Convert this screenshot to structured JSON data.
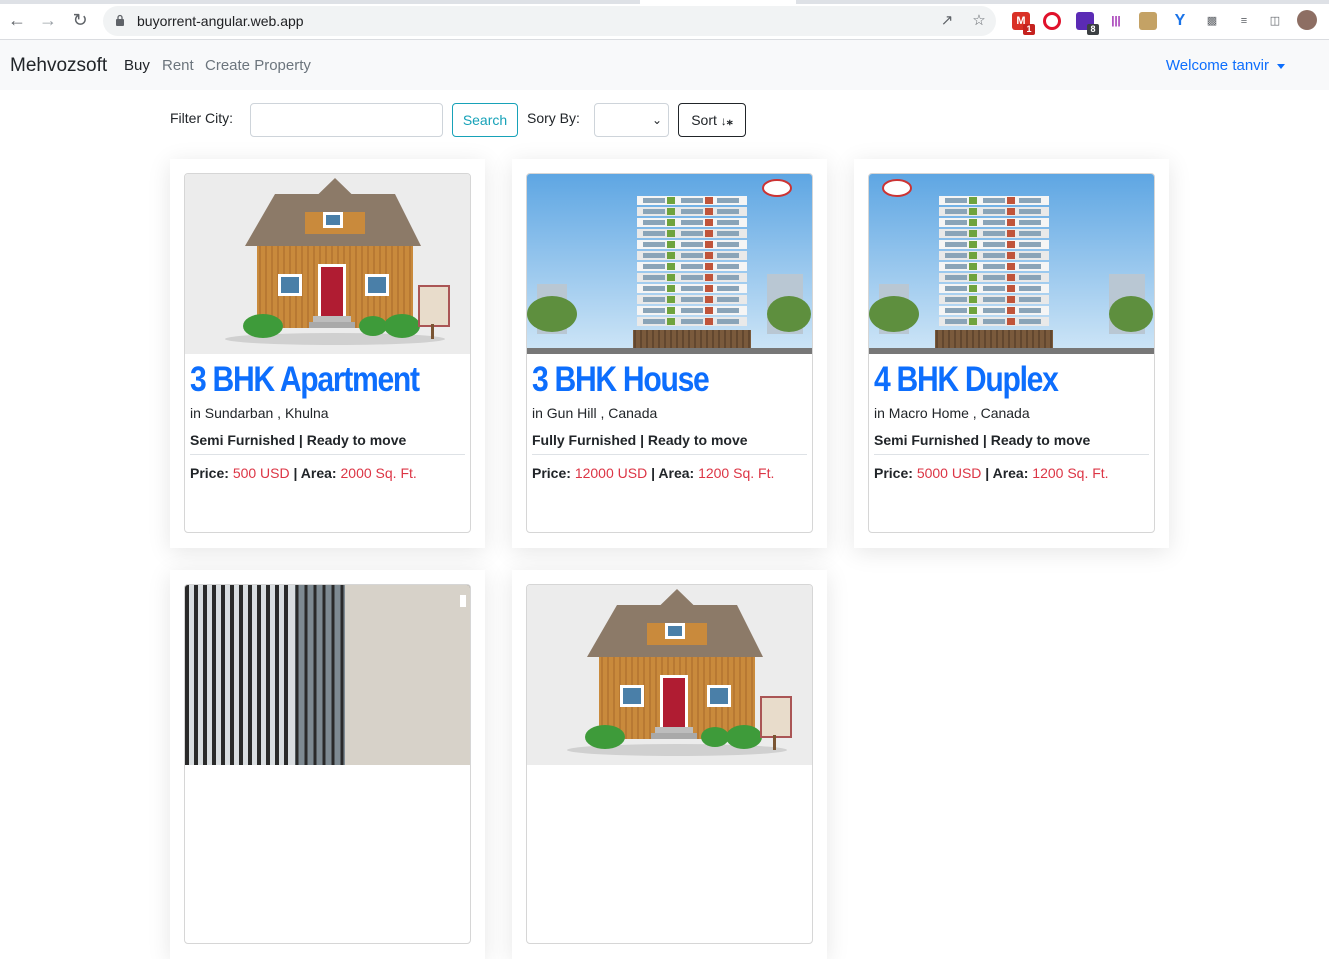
{
  "browser": {
    "url": "buyorrent-angular.web.app",
    "extensions": [
      {
        "name": "gmail-icon",
        "badge": "1",
        "color": "#d93025"
      },
      {
        "name": "opera-icon",
        "badge": "",
        "color": "#e0112b"
      },
      {
        "name": "extension-purple-icon",
        "badge": "8",
        "color": "#5b2bb5"
      },
      {
        "name": "library-icon",
        "badge": "",
        "color": "#9c27b0"
      },
      {
        "name": "folder-face-icon",
        "badge": "",
        "color": "#c4a265"
      },
      {
        "name": "y-extension-icon",
        "badge": "",
        "color": "#1a73e8"
      },
      {
        "name": "puzzle-icon",
        "badge": "",
        "color": "#5f6368"
      },
      {
        "name": "media-list-icon",
        "badge": "",
        "color": "#5f6368"
      },
      {
        "name": "side-panel-icon",
        "badge": "",
        "color": "#5f6368"
      }
    ]
  },
  "navbar": {
    "brand": "Mehvozsoft",
    "links": [
      {
        "label": "Buy",
        "active": true
      },
      {
        "label": "Rent",
        "active": false
      },
      {
        "label": "Create Property",
        "active": false
      }
    ],
    "welcome": "Welcome tanvir"
  },
  "filters": {
    "city_label": "Filter City:",
    "city_value": "",
    "search_label": "Search",
    "sort_label": "Sory By:",
    "sort_value": "",
    "sort_button": "Sort"
  },
  "properties": [
    {
      "title": "3 BHK Apartment",
      "location": "in Sundarban , Khulna",
      "furnishing": "Semi Furnished | Ready to move",
      "price_label": "Price:",
      "price": "500 USD",
      "area_label": "| Area:",
      "area": "2000 Sq. Ft.",
      "image": "house"
    },
    {
      "title": "3 BHK House",
      "location": "in Gun Hill , Canada",
      "furnishing": "Fully Furnished | Ready to move",
      "price_label": "Price:",
      "price": "12000 USD",
      "area_label": "| Area:",
      "area": "1200 Sq. Ft.",
      "image": "tower"
    },
    {
      "title": "4 BHK Duplex",
      "location": "in Macro Home , Canada",
      "furnishing": "Semi Furnished | Ready to move",
      "price_label": "Price:",
      "price": "5000 USD",
      "area_label": "| Area:",
      "area": "1200 Sq. Ft.",
      "image": "tower"
    },
    {
      "image": "interior"
    },
    {
      "image": "house"
    }
  ],
  "colors": {
    "accent": "#0d6efd",
    "price_red": "#dc3545",
    "search_teal": "#17a2b8"
  }
}
